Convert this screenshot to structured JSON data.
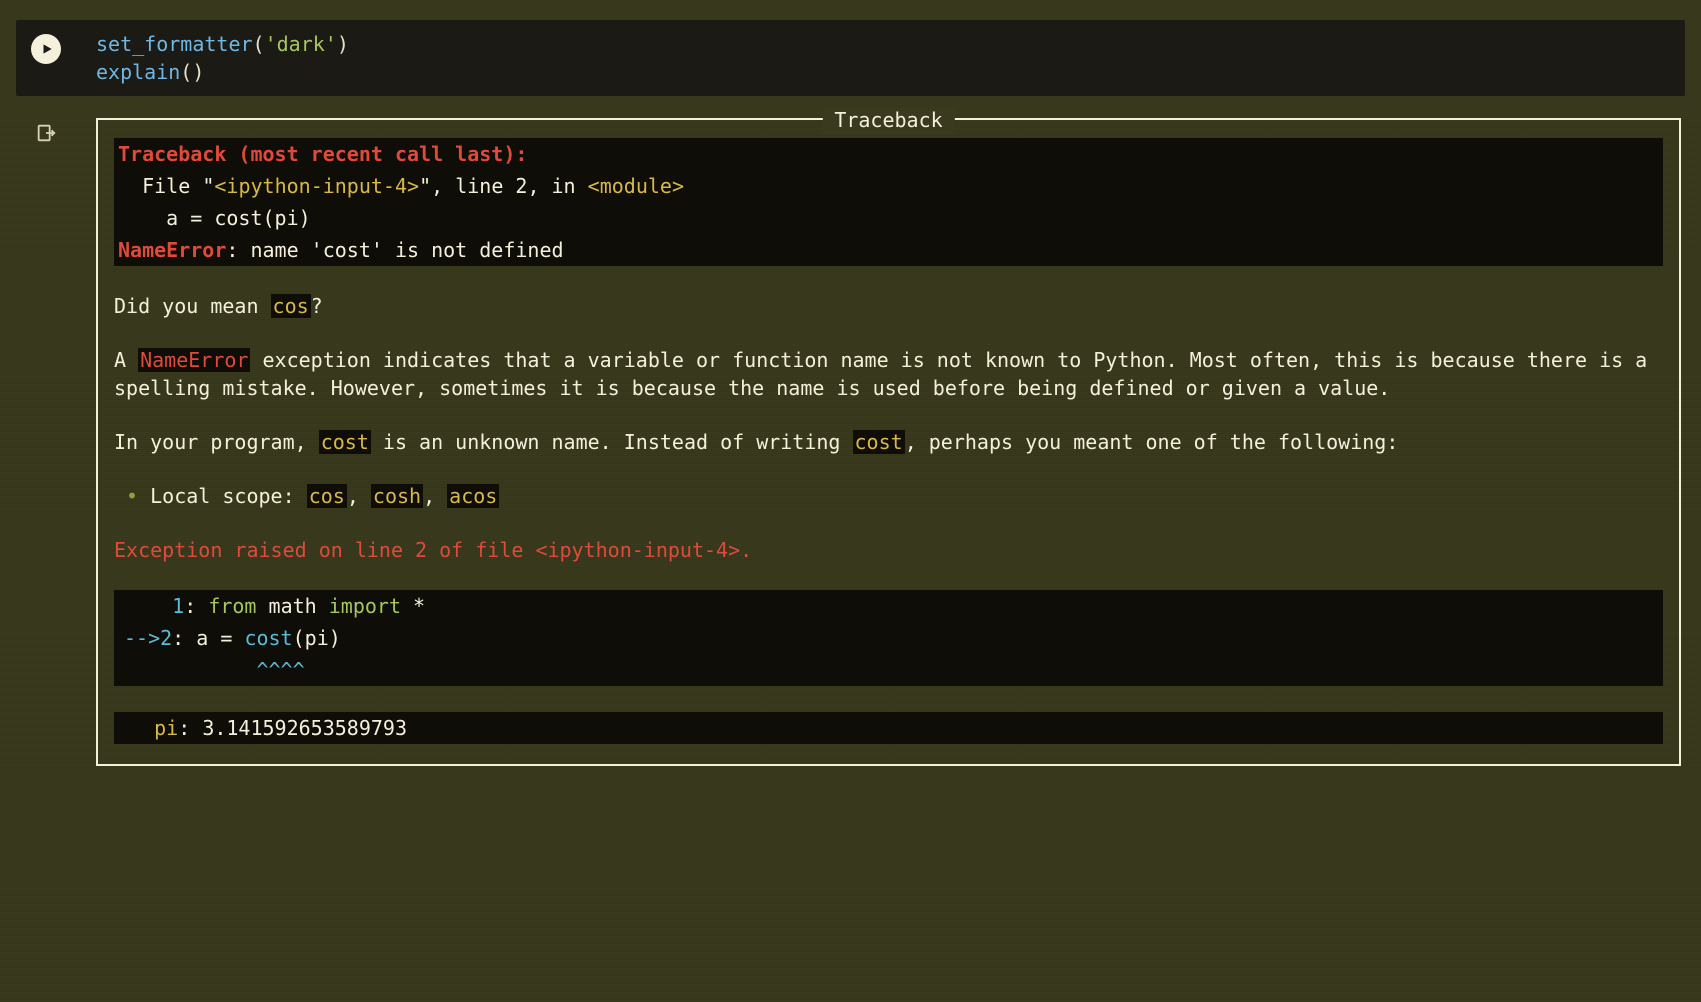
{
  "cell": {
    "code_line1_fn": "set_formatter",
    "code_line1_open": "(",
    "code_line1_str": "'dark'",
    "code_line1_close": ")",
    "code_line2_fn": "explain",
    "code_line2_parens": "()"
  },
  "output": {
    "legend": "Traceback",
    "tb_header": "Traceback (most recent call last):",
    "tb_file_prefix": "  File ",
    "tb_file_quote1": "\"",
    "tb_file_name": "<ipython-input-4>",
    "tb_file_quote2": "\"",
    "tb_file_rest": ", line 2, in ",
    "tb_file_mod": "<module>",
    "tb_code_line": "    a = cost(pi)",
    "tb_err_name": "NameError",
    "tb_err_sep": ": ",
    "tb_err_msg": "name 'cost' is not defined",
    "did_you_mean_pre": "Did you mean ",
    "did_you_mean_sugg": "cos",
    "did_you_mean_post": "?",
    "explain_p1_pre": "A ",
    "explain_p1_err": "NameError",
    "explain_p1_rest": " exception indicates that a variable or function name is not known to Python. Most often, this is because there is a spelling mistake. However, sometimes it is because the name is used before being defined or given a value.",
    "explain_p2_pre": "In your program, ",
    "explain_p2_name": "cost",
    "explain_p2_mid": " is an unknown name. Instead of writing ",
    "explain_p2_name2": "cost",
    "explain_p2_post": ", perhaps you meant one of the following:",
    "scope_bullet": " • ",
    "scope_label": "Local scope: ",
    "scope_s1": "cos",
    "scope_sep1": ", ",
    "scope_s2": "cosh",
    "scope_sep2": ", ",
    "scope_s3": "acos",
    "exc_line_pre": "Exception raised on line 2 of file ",
    "exc_line_file": "<ipython-input-4>",
    "exc_line_post": ".",
    "ctx_l1_num": "    1",
    "ctx_l1_colon": ": ",
    "ctx_l1_kw1": "from",
    "ctx_l1_mod": " math ",
    "ctx_l1_kw2": "import",
    "ctx_l1_star": " *",
    "ctx_l2_arrow": "-->",
    "ctx_l2_num": "2",
    "ctx_l2_colon": ": ",
    "ctx_l2_code_pre": "a = ",
    "ctx_l2_code_fn": "cost",
    "ctx_l2_code_args": "(pi)",
    "ctx_l3_caret": "           ^^^^",
    "var_name": "pi",
    "var_sep": ": ",
    "var_val": "3.141592653589793"
  }
}
